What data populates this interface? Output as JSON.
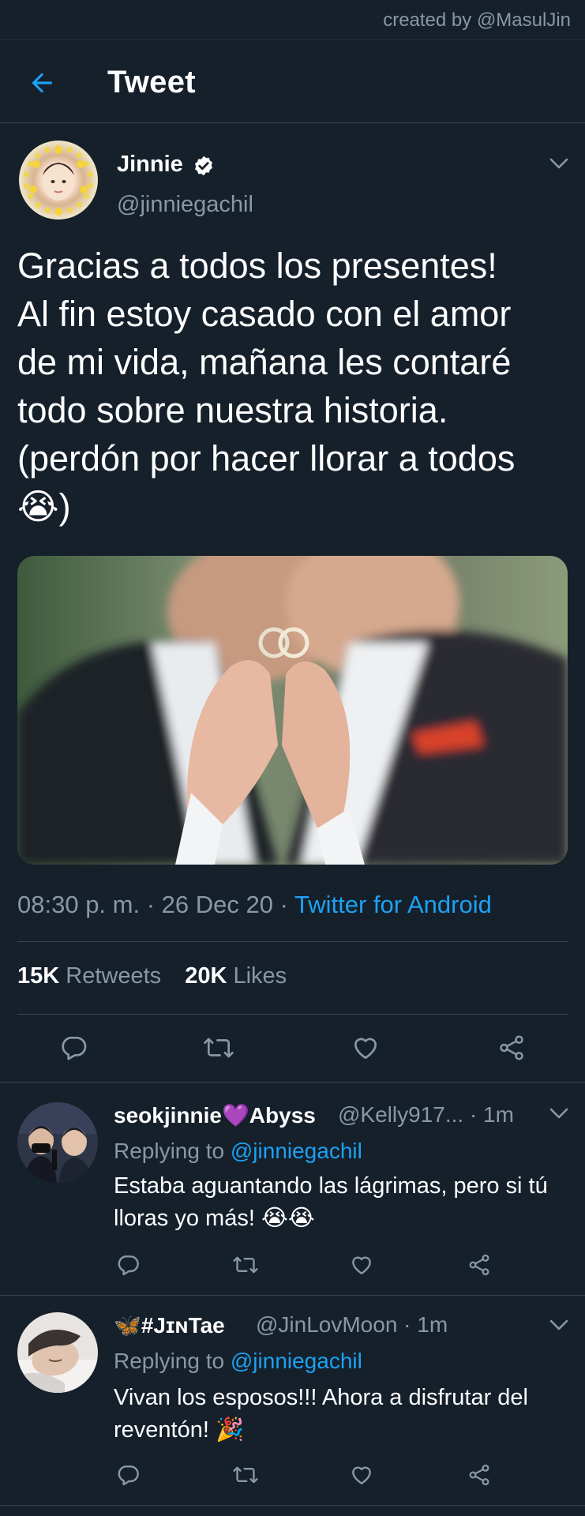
{
  "credit": "created by @MasulJin",
  "header": {
    "title": "Tweet",
    "back_icon": "arrow-left-icon"
  },
  "tweet": {
    "author_name": "Jinnie",
    "author_handle": "@jinniegachil",
    "verified_icon": "verified-badge-icon",
    "text": "Gracias a todos los presentes!\nAl fin estoy casado con el amor\nde mi vida, mañana les contaré\ntodo sobre nuestra historia.\n(perdón por hacer llorar a todos\n😭)",
    "time": "08:30 p. m.",
    "date": "26 Dec 20",
    "sep": "·",
    "source": "Twitter for Android",
    "retweets_count": "15K",
    "retweets_label": "Retweets",
    "likes_count": "20K",
    "likes_label": "Likes"
  },
  "replies": [
    {
      "name": "seokjinnie💜Abyss",
      "handle": "@Kelly917... · 1m",
      "replying_prefix": "Replying to",
      "replying_handle": "@jinniegachil",
      "text": "Estaba aguantando las lágrimas, pero si tú lloras yo más! 😭😭"
    },
    {
      "name": "🦋#JɪɴTae",
      "handle": "@JinLovMoon · 1m",
      "replying_prefix": "Replying to",
      "replying_handle": "@jinniegachil",
      "text": "Vivan los esposos!!! Ahora a disfrutar del reventón! 🎉"
    }
  ],
  "icons": {
    "reply": "comment-icon",
    "retweet": "retweet-icon",
    "like": "heart-icon",
    "share": "share-icon",
    "more": "chevron-down-icon"
  },
  "colors": {
    "background": "#15202b",
    "accent": "#1da1f2",
    "muted": "#8899a6",
    "divider": "#38444d"
  }
}
